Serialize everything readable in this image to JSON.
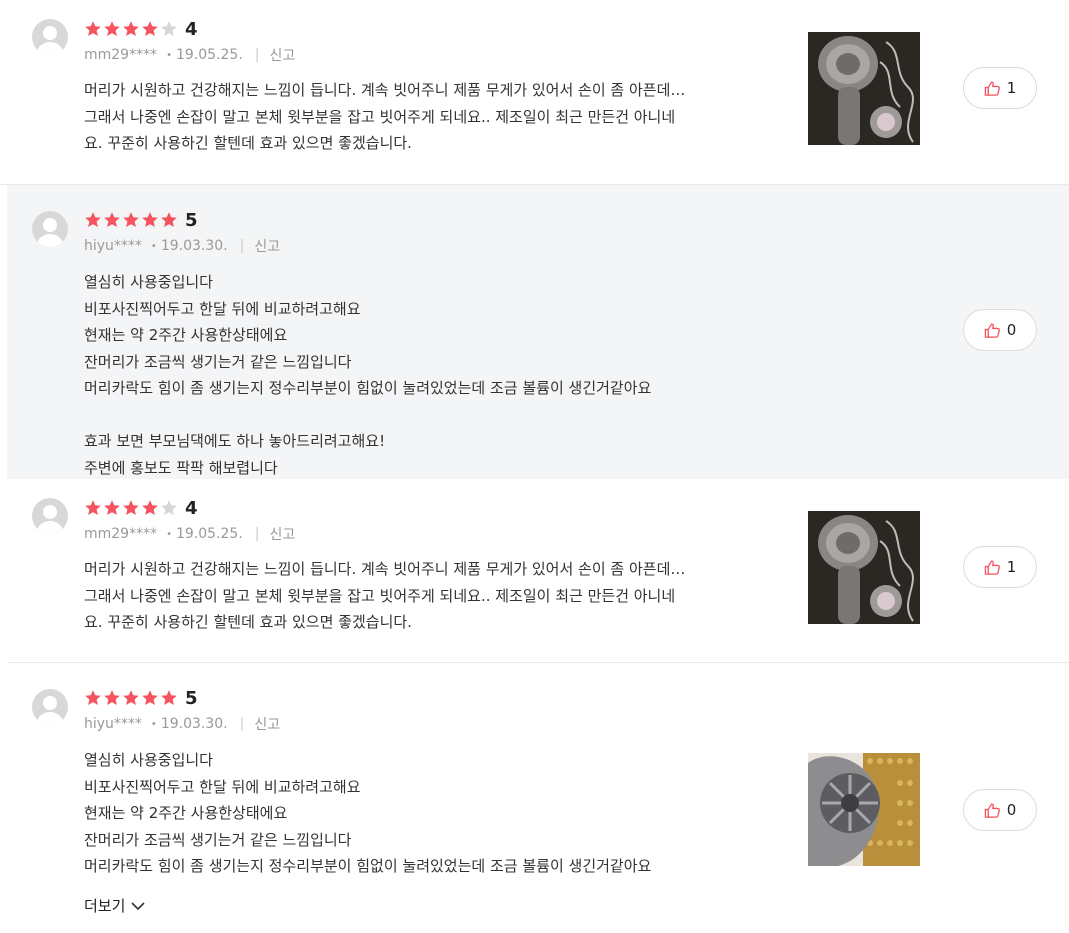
{
  "colors": {
    "star_on": "#f5535f",
    "star_off": "#d6d6d6",
    "like_icon": "#f5535f",
    "highlight_bg": "#f4f5f7"
  },
  "reviews": [
    {
      "rating": 4,
      "score": "4",
      "user": "mm29****",
      "date": "19.05.25.",
      "report": "신고",
      "lines": [
        "머리가 시원하고 건강해지는 느낌이 듭니다. 계속 빗어주니 제품 무게가 있어서 손이 좀 아픈데…",
        "그래서 나중엔 손잡이 말고 본체 윗부분을 잡고 빗어주게 되네요.. 제조일이 최근 만든건 아니네",
        "요. 꾸준히 사용하긴 할텐데 효과 있으면 좋겠습니다."
      ],
      "likes": "1",
      "photo": "dark-brush-photo",
      "highlight": false
    },
    {
      "rating": 5,
      "score": "5",
      "user": "hiyu****",
      "date": "19.03.30.",
      "report": "신고",
      "lines": [
        "열심히 사용중입니다",
        "비포사진찍어두고 한달 뒤에 비교하려고해요",
        "현재는 약 2주간 사용한상태에요",
        "잔머리가 조금씩 생기는거 같은 느낌입니다",
        "머리카락도 힘이 좀 생기는지 정수리부분이 힘없이 눌려있었는데 조금 볼륨이 생긴거같아요",
        "",
        "효과 보면 부모님댁에도 하나 놓아드리려고해요!",
        "주변에 홍보도 팍팍 해보렵니다"
      ],
      "likes": "0",
      "photo": "",
      "highlight": true
    },
    {
      "rating": 4,
      "score": "4",
      "user": "mm29****",
      "date": "19.05.25.",
      "report": "신고",
      "lines": [
        "머리가 시원하고 건강해지는 느낌이 듭니다. 계속 빗어주니 제품 무게가 있어서 손이 좀 아픈데…",
        "그래서 나중엔 손잡이 말고 본체 윗부분을 잡고 빗어주게 되네요.. 제조일이 최근 만든건 아니네",
        "요. 꾸준히 사용하긴 할텐데 효과 있으면 좋겠습니다."
      ],
      "likes": "1",
      "photo": "dark-brush-photo",
      "highlight": false
    },
    {
      "rating": 5,
      "score": "5",
      "user": "hiyu****",
      "date": "19.03.30.",
      "report": "신고",
      "lines": [
        "열심히 사용중입니다",
        "비포사진찍어두고 한달 뒤에 비교하려고해요",
        "현재는 약 2주간 사용한상태에요",
        "잔머리가 조금씩 생기는거 같은 느낌입니다",
        "머리카락도 힘이 좀 생기는지 정수리부분이 힘없이 눌려있었는데 조금 볼륨이 생긴거같아요"
      ],
      "likes": "0",
      "photo": "gold-brush-photo",
      "highlight": false
    }
  ],
  "more_label": "더보기"
}
